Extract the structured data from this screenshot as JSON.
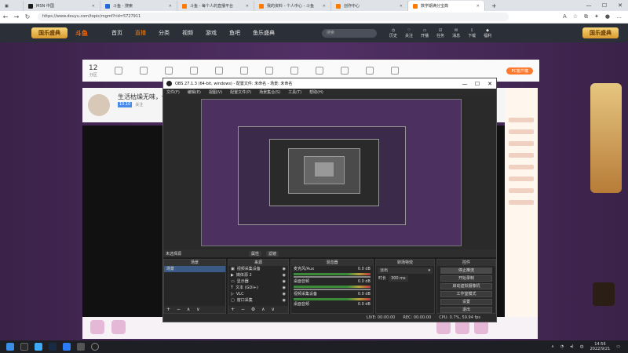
{
  "browser": {
    "tabs": [
      {
        "title": "MSN 中国",
        "color": "#1a1a1a"
      },
      {
        "title": "斗鱼 - 搜索",
        "color": "#2468d8"
      },
      {
        "title": "斗鱼 - 每个人的直播平台",
        "color": "#ff7a00"
      },
      {
        "title": "我的资料 - 个人中心 - 斗鱼",
        "color": "#ff7a00"
      },
      {
        "title": "创作中心",
        "color": "#ff7a00"
      },
      {
        "title": "数学期满分宝典",
        "color": "#ff7a00"
      }
    ],
    "new_tab": "+",
    "url": "https://www.douyu.com/topic/mgmf?rid=5727911",
    "window_controls": {
      "min": "—",
      "max": "☐",
      "close": "✕"
    }
  },
  "site": {
    "logo": "国乐盛典",
    "brand": "斗鱼",
    "nav": [
      "首页",
      "直播",
      "分类",
      "视频",
      "游戏",
      "鱼吧",
      "鱼乐盛典"
    ],
    "search_placeholder": "搜索",
    "header_icons": [
      "历史",
      "关注",
      "开播",
      "任务",
      "消息",
      "下载",
      "福利"
    ],
    "right_logo": "国乐盛典"
  },
  "page": {
    "category_count": "12",
    "category_count_label": "分区",
    "category_pill": "PC客户端",
    "streamer_title": "生活枯燥无味，你",
    "streamer_tags": [
      "10.10",
      "关注"
    ]
  },
  "obs": {
    "title": "OBS 27.1.3 (64-bit, windows) - 配置文件: 未命名 - 场景: 未命名",
    "menu": [
      "文件(F)",
      "编辑(E)",
      "视图(V)",
      "配置文件(P)",
      "场景集合(S)",
      "工具(T)",
      "帮助(H)"
    ],
    "source_bar": {
      "label": "未选择源",
      "props": "属性",
      "filters": "滤镜"
    },
    "scenes": {
      "header": "场景",
      "items": [
        "场景"
      ]
    },
    "sources": {
      "header": "来源",
      "items": [
        "视频采集设备",
        "媒体源 2",
        "显示器",
        "文本 (GDI+)",
        "VLC",
        "窗口采集"
      ]
    },
    "mixer": {
      "header": "混音器",
      "channels": [
        {
          "name": "麦克风/Aux",
          "db": "0.0 dB"
        },
        {
          "name": "桌面音频",
          "db": "0.0 dB"
        },
        {
          "name": "视频采集设备",
          "db": "0.0 dB"
        },
        {
          "name": "桌面音频",
          "db": "0.0 dB"
        }
      ]
    },
    "transitions": {
      "header": "转场特效",
      "type": "淡出",
      "duration_label": "时长",
      "duration": "300 ms"
    },
    "controls": {
      "header": "控件",
      "buttons": [
        "停止推流",
        "开始录制",
        "启动虚拟摄像机",
        "工作室模式",
        "设置",
        "退出"
      ]
    },
    "status": {
      "live": "LIVE: 00:00:00",
      "rec": "REC: 00:00:00",
      "cpu": "CPU: 0.7%, 59.94 fps"
    }
  },
  "taskbar": {
    "time": "14:56",
    "date": "2022/9/21",
    "lang": "中"
  }
}
